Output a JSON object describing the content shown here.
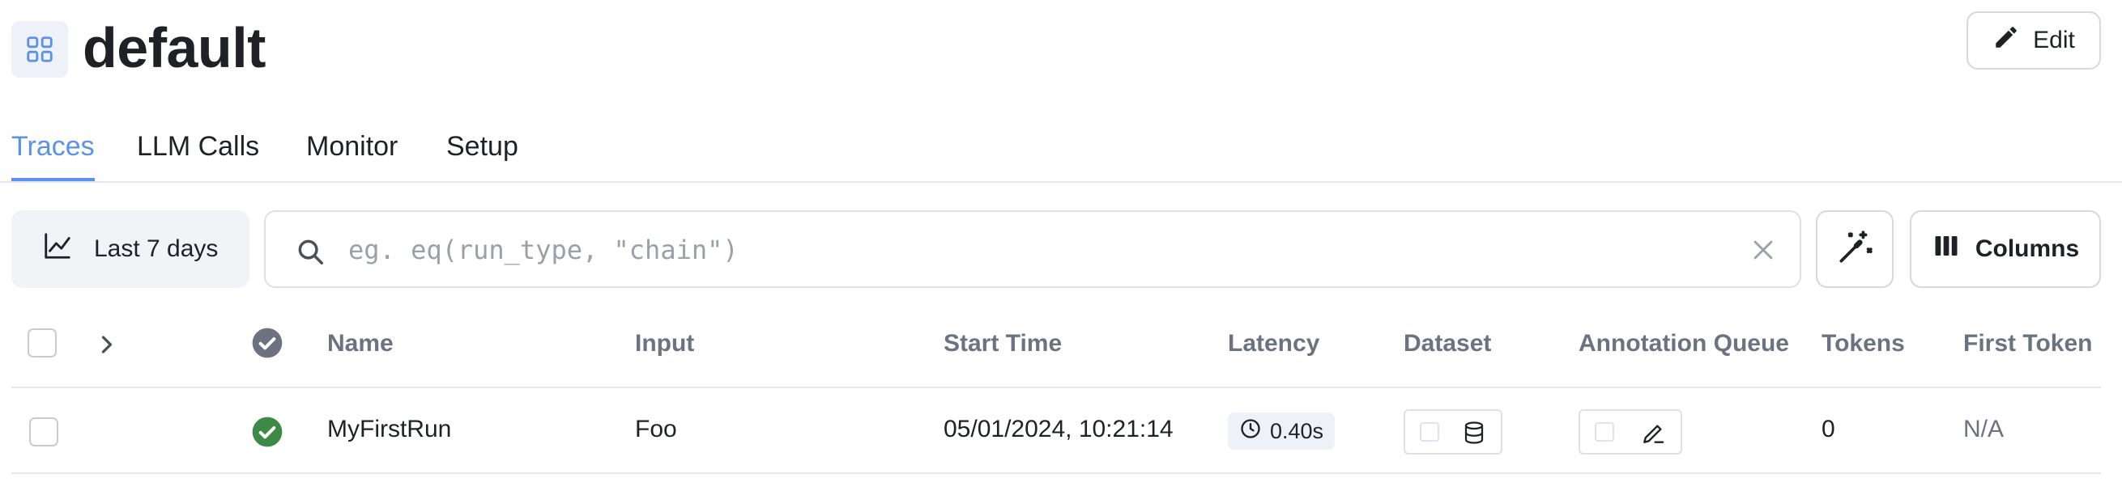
{
  "header": {
    "title": "default",
    "edit_label": "Edit"
  },
  "tabs": [
    {
      "label": "Traces",
      "active": true
    },
    {
      "label": "LLM Calls",
      "active": false
    },
    {
      "label": "Monitor",
      "active": false
    },
    {
      "label": "Setup",
      "active": false
    }
  ],
  "toolbar": {
    "range_label": "Last 7 days",
    "search_placeholder": "eg. eq(run_type, \"chain\")",
    "columns_label": "Columns"
  },
  "table": {
    "headers": {
      "name": "Name",
      "input": "Input",
      "start_time": "Start Time",
      "latency": "Latency",
      "dataset": "Dataset",
      "annotation_queue": "Annotation Queue",
      "tokens": "Tokens",
      "first_token": "First Token"
    },
    "rows": [
      {
        "status": "success",
        "name": "MyFirstRun",
        "input": "Foo",
        "start_time": "05/01/2024, 10:21:14",
        "latency": "0.40s",
        "tokens": "0",
        "first_token": "N/A"
      }
    ]
  },
  "colors": {
    "accent": "#5b91e6",
    "success": "#3c8a45",
    "muted": "#6b7280"
  }
}
